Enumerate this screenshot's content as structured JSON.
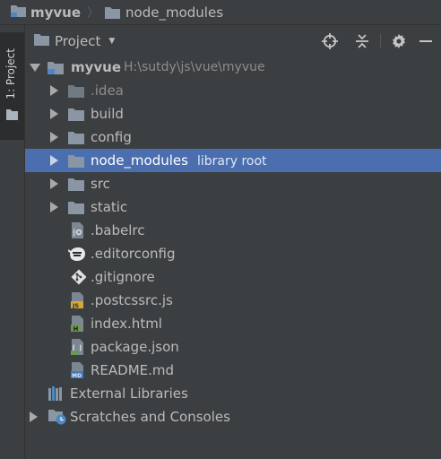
{
  "breadcrumb": {
    "project": "myvue",
    "separator": "〉",
    "module": "node_modules"
  },
  "strip": {
    "tab_label": "1: Project"
  },
  "tool_window": {
    "title": "Project"
  },
  "tree": {
    "root": {
      "name": "myvue",
      "path": "H:\\sutdy\\js\\vue\\myvue"
    },
    "folders": [
      {
        "name": ".idea"
      },
      {
        "name": "build"
      },
      {
        "name": "config"
      },
      {
        "name": "node_modules",
        "hint": "library root"
      },
      {
        "name": "src"
      },
      {
        "name": "static"
      }
    ],
    "files": [
      {
        "name": ".babelrc"
      },
      {
        "name": ".editorconfig"
      },
      {
        "name": ".gitignore"
      },
      {
        "name": ".postcssrc.js"
      },
      {
        "name": "index.html"
      },
      {
        "name": "package.json"
      },
      {
        "name": "README.md"
      }
    ],
    "external_libraries": "External Libraries",
    "scratches": "Scratches and Consoles"
  },
  "colors": {
    "background": "#3c3f41",
    "selection": "#4b6eaf",
    "folder": "#8a96a3",
    "text": "#bbbbbb"
  }
}
